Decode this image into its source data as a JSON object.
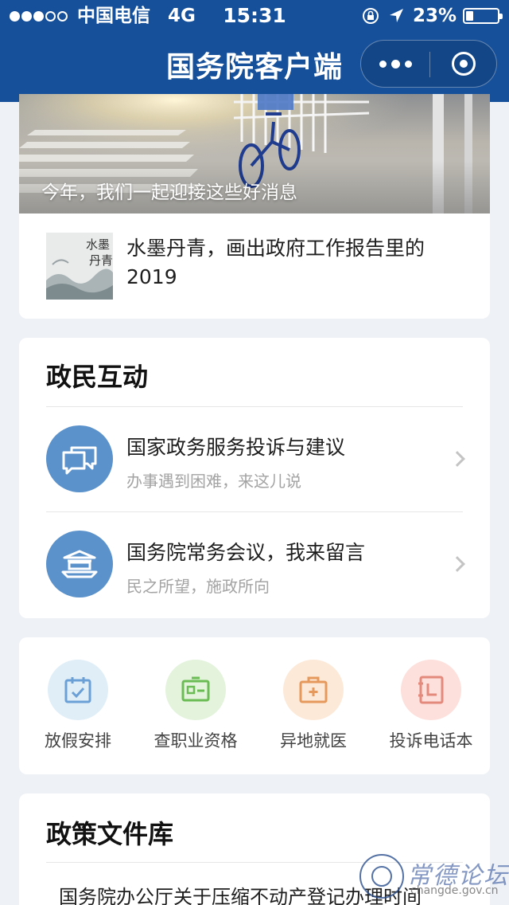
{
  "status_bar": {
    "carrier": "中国电信",
    "network": "4G",
    "time": "15:31",
    "battery": "23%",
    "battery_level": 0.23
  },
  "header": {
    "title": "国务院客户端"
  },
  "featured": {
    "banner_caption": "今年，我们一起迎接这些好消息",
    "news_title": "水墨丹青，画出政府工作报告里的2019",
    "thumb_text": "水墨丹青"
  },
  "interaction": {
    "title": "政民互动",
    "items": [
      {
        "title": "国家政务服务投诉与建议",
        "subtitle": "办事遇到困难，来这儿说"
      },
      {
        "title": "国务院常务会议，我来留言",
        "subtitle": "民之所望，施政所向"
      }
    ]
  },
  "services": [
    {
      "label": "放假安排",
      "bg": "#e0eef8",
      "fg": "#6ba0d6"
    },
    {
      "label": "查职业资格",
      "bg": "#e3f3dc",
      "fg": "#6cbc55"
    },
    {
      "label": "异地就医",
      "bg": "#fde9d8",
      "fg": "#e6995c"
    },
    {
      "label": "投诉电话本",
      "bg": "#fde0dc",
      "fg": "#e48a7c"
    }
  ],
  "policy": {
    "title": "政策文件库",
    "first_item": "国务院办公厅关于压缩不动产登记办理时间"
  },
  "watermark": {
    "name": "常德论坛",
    "url": "changde.gov.cn"
  }
}
